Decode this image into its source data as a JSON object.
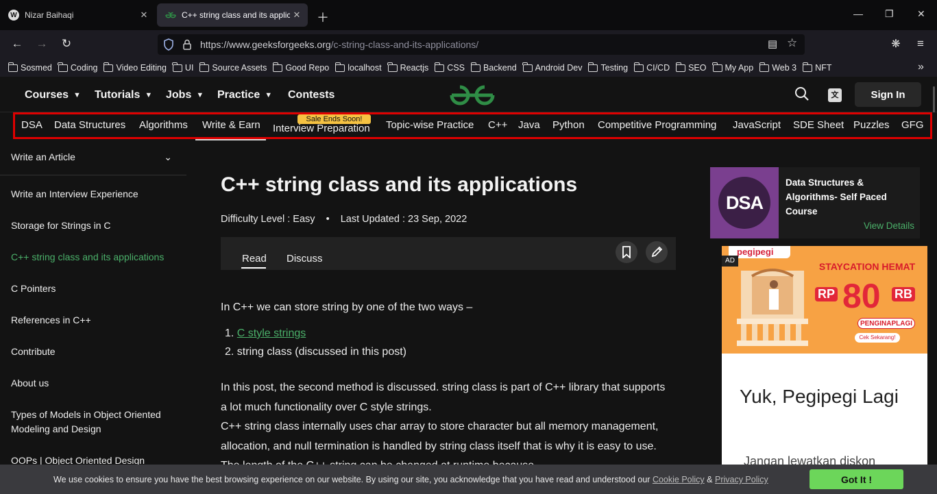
{
  "browser": {
    "tabs": [
      {
        "title": "Nizar Baihaqi",
        "favicon": "W",
        "active": false
      },
      {
        "title": "C++ string class and its applicat",
        "favicon": "GfG",
        "active": true
      }
    ],
    "url_host": "https://www.geeksforgeeks.org",
    "url_path": "/c-string-class-and-its-applications/",
    "bookmarks": [
      "Sosmed",
      "Coding",
      "Video Editing",
      "UI",
      "Source Assets",
      "Good Repo",
      "localhost",
      "Reactjs",
      "CSS",
      "Backend",
      "Android Dev",
      "Testing",
      "CI/CD",
      "SEO",
      "My App",
      "Web 3",
      "NFT"
    ]
  },
  "header": {
    "menus": [
      "Courses",
      "Tutorials",
      "Jobs",
      "Practice",
      "Contests"
    ],
    "sign_in": "Sign In",
    "brand_color": "#2f8d46"
  },
  "subnav": {
    "items": [
      "DSA",
      "Data Structures",
      "Algorithms",
      "Write & Earn",
      "Interview Preparation",
      "Topic-wise Practice",
      "C++",
      "Java",
      "Python",
      "Competitive Programming",
      "JavaScript",
      "SDE Sheet",
      "Puzzles",
      "GFG"
    ],
    "sale_badge": "Sale Ends Soon!",
    "highlight_color": "#e00000"
  },
  "sidebar": {
    "header": "Write an Article",
    "items": [
      "Write an Interview Experience",
      "Storage for Strings in C",
      "C++ string class and its applications",
      "C Pointers",
      "References in C++",
      "Contribute",
      "About us",
      "Types of Models in Object Oriented Modeling and Design",
      "OOPs | Object Oriented Design"
    ],
    "active_index": 2
  },
  "article": {
    "title": "C++ string class and its applications",
    "difficulty": "Difficulty Level : Easy",
    "bullet": "•",
    "updated": "Last Updated : 23 Sep, 2022",
    "tabs": [
      "Read",
      "Discuss"
    ],
    "intro": "In C++ we can store string by one of the two ways –",
    "list": [
      "C style strings",
      "string class (discussed in this post)"
    ],
    "para1": "In this post, the second method is discussed. string class is part of C++ library that supports a lot much functionality over C style strings.",
    "para2": "C++ string class internally uses char array to store character but all memory management, allocation, and null termination is handled by string class itself that is why it is easy to use. The length of the C++ string can be changed at runtime because"
  },
  "course_card": {
    "thumb_text": "DSA",
    "title": "Data Structures & Algorithms- Self Paced Course",
    "cta": "View Details"
  },
  "ad": {
    "label": "AD",
    "brand": "pegipegi",
    "headline1": "STAYCATION HEMAT",
    "rp": "RP",
    "amount": "80",
    "rb": "RB",
    "code": "PENGINAPLAGI",
    "cta": "Cek Sekarang!",
    "title": "Yuk, Pegipegi Lagi",
    "subtitle": "Jangan lewatkan diskon"
  },
  "cookie": {
    "text": "We use cookies to ensure you have the best browsing experience on our website. By using our site, you acknowledge that you have read and understood our",
    "cookie_policy": "Cookie Policy",
    "amp": "&",
    "privacy_policy": "Privacy Policy",
    "button": "Got It !"
  }
}
